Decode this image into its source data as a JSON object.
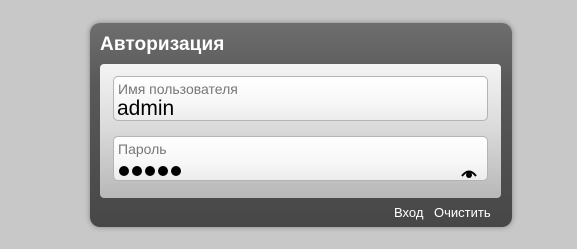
{
  "dialog": {
    "title": "Авторизация"
  },
  "username": {
    "label": "Имя пользователя",
    "value": "admin"
  },
  "password": {
    "label": "Пароль",
    "masked_length": 5,
    "toggle_icon": "eye-icon"
  },
  "actions": {
    "login_label": "Вход",
    "clear_label": "Очистить"
  }
}
